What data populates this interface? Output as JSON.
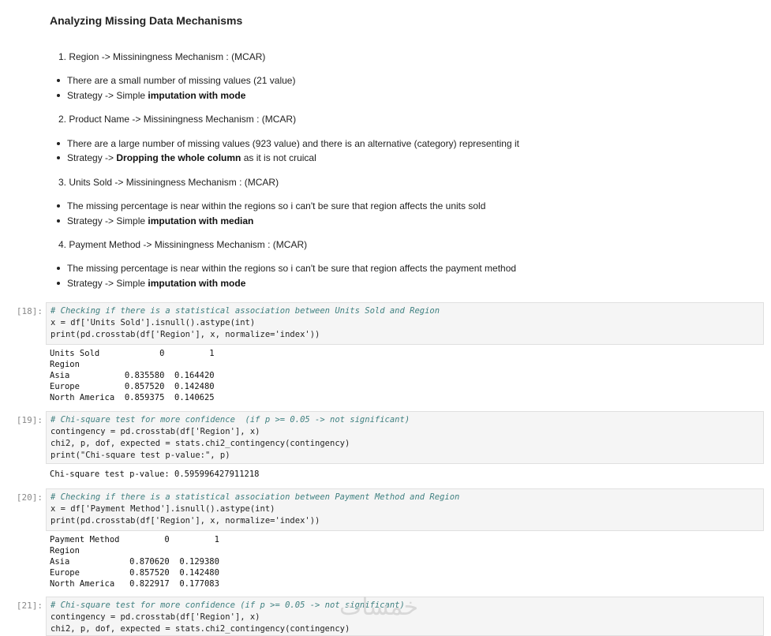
{
  "markdown": {
    "title": "Analyzing Missing Data Mechanisms",
    "sections": [
      {
        "heading": "1. Region -> Missiningness Mechanism : (MCAR)",
        "bullets": [
          {
            "text": "There are a small number of missing values (21 value)",
            "pre": "",
            "bold": "",
            "post": ""
          },
          {
            "text": "",
            "pre": "Strategy -> Simple ",
            "bold": "imputation with mode",
            "post": ""
          }
        ]
      },
      {
        "heading": "2. Product Name -> Missiningness Mechanism : (MCAR)",
        "bullets": [
          {
            "text": "There are a large number of missing values (923 value) and there is an alternative (category) representing it",
            "pre": "",
            "bold": "",
            "post": ""
          },
          {
            "text": "",
            "pre": "Strategy -> ",
            "bold": "Dropping the whole column",
            "post": " as it is not cruical"
          }
        ]
      },
      {
        "heading": "3. Units Sold -> Missiningness Mechanism : (MCAR)",
        "bullets": [
          {
            "text": "The missing percentage is near within the regions so i can't be sure that region affects the units sold",
            "pre": "",
            "bold": "",
            "post": ""
          },
          {
            "text": "",
            "pre": "Strategy -> Simple ",
            "bold": "imputation with median",
            "post": ""
          }
        ]
      },
      {
        "heading": "4. Payment Method -> Missiningness Mechanism : (MCAR)",
        "bullets": [
          {
            "text": "The missing percentage is near within the regions so i can't be sure that region affects the payment method",
            "pre": "",
            "bold": "",
            "post": ""
          },
          {
            "text": "",
            "pre": "Strategy -> Simple ",
            "bold": "imputation with mode",
            "post": ""
          }
        ]
      }
    ]
  },
  "cells": [
    {
      "prompt": "[18]:",
      "code": [
        "# Checking if there is a statistical association between Units Sold and Region",
        "x = df['Units Sold'].isnull().astype(int)",
        "print(pd.crosstab(df['Region'], x, normalize='index'))"
      ],
      "output": [
        "Units Sold            0         1",
        "Region",
        "Asia           0.835580  0.164420",
        "Europe         0.857520  0.142480",
        "North America  0.859375  0.140625"
      ]
    },
    {
      "prompt": "[19]:",
      "code": [
        "# Chi-square test for more confidence  (if p >= 0.05 -> not significant)",
        "contingency = pd.crosstab(df['Region'], x)",
        "chi2, p, dof, expected = stats.chi2_contingency(contingency)",
        "print(\"Chi-square test p-value:\", p)"
      ],
      "output": [
        "Chi-square test p-value: 0.595996427911218"
      ]
    },
    {
      "prompt": "[20]:",
      "code": [
        "# Checking if there is a statistical association between Payment Method and Region",
        "x = df['Payment Method'].isnull().astype(int)",
        "print(pd.crosstab(df['Region'], x, normalize='index'))"
      ],
      "output": [
        "Payment Method         0         1",
        "Region",
        "Asia            0.870620  0.129380",
        "Europe          0.857520  0.142480",
        "North America   0.822917  0.177083"
      ]
    },
    {
      "prompt": "[21]:",
      "code": [
        "# Chi-square test for more confidence (if p >= 0.05 -> not significant)",
        "contingency = pd.crosstab(df['Region'], x)",
        "chi2, p, dof, expected = stats.chi2_contingency(contingency)"
      ],
      "output": []
    }
  ],
  "watermark": "خمسات"
}
